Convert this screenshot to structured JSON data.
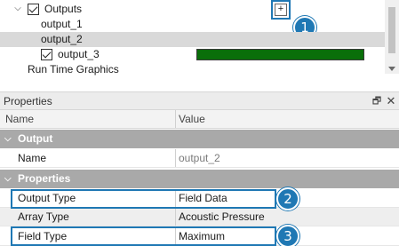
{
  "tree": {
    "outputs_label": "Outputs",
    "items": [
      {
        "label": "output_1"
      },
      {
        "label": "output_2"
      },
      {
        "label": "output_3"
      }
    ],
    "run_time_graphics_label": "Run Time Graphics",
    "add_button_glyph": "+",
    "output_3_progress": 1.0,
    "progress_color": "#0a6f0a"
  },
  "callouts": [
    "1",
    "2",
    "3"
  ],
  "properties": {
    "title": "Properties",
    "pin_icon": "pin-icon",
    "close_icon": "close-icon",
    "columns": {
      "name": "Name",
      "value": "Value"
    },
    "sections": [
      {
        "title": "Output",
        "rows": [
          {
            "name": "Name",
            "value": "output_2"
          }
        ]
      },
      {
        "title": "Properties",
        "rows": [
          {
            "name": "Output Type",
            "value": "Field Data"
          },
          {
            "name": "Array Type",
            "value": "Acoustic Pressure"
          },
          {
            "name": "Field Type",
            "value": "Maximum"
          }
        ]
      }
    ],
    "highlight_color": "#1f78b4"
  }
}
